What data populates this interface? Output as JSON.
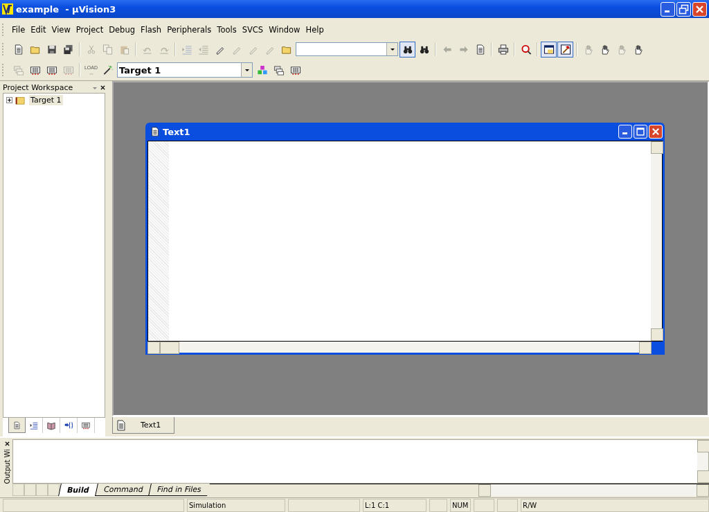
{
  "window": {
    "title": "example  - µVision3"
  },
  "menu": [
    "File",
    "Edit",
    "View",
    "Project",
    "Debug",
    "Flash",
    "Peripherals",
    "Tools",
    "SVCS",
    "Window",
    "Help"
  ],
  "toolbar1": {
    "groups": [
      [
        {
          "kind": "page",
          "disabled": false,
          "pressed": false
        },
        {
          "kind": "folder",
          "disabled": false,
          "pressed": false
        },
        {
          "kind": "floppy",
          "disabled": false,
          "pressed": false
        },
        {
          "kind": "floppies",
          "disabled": false,
          "pressed": false
        }
      ],
      [
        {
          "kind": "scissors",
          "disabled": true,
          "pressed": false
        },
        {
          "kind": "pages",
          "disabled": true,
          "pressed": false
        },
        {
          "kind": "clipboard",
          "disabled": true,
          "pressed": false
        }
      ],
      [
        {
          "kind": "undo",
          "disabled": true,
          "pressed": false
        },
        {
          "kind": "redo",
          "disabled": true,
          "pressed": false
        }
      ],
      [
        {
          "kind": "indent",
          "disabled": true,
          "pressed": false
        },
        {
          "kind": "outdent",
          "disabled": true,
          "pressed": false
        },
        {
          "kind": "pencil",
          "disabled": false,
          "pressed": false
        },
        {
          "kind": "pencil",
          "disabled": true,
          "pressed": false
        },
        {
          "kind": "pencil",
          "disabled": true,
          "pressed": false
        },
        {
          "kind": "pencil",
          "disabled": true,
          "pressed": false
        },
        {
          "kind": "folder",
          "disabled": false,
          "pressed": false
        }
      ]
    ],
    "groups_after": [
      [
        {
          "kind": "binoculars",
          "disabled": false,
          "pressed": true
        },
        {
          "kind": "binoculars",
          "disabled": false,
          "pressed": false
        }
      ],
      [
        {
          "kind": "arrow-left",
          "disabled": true,
          "pressed": false
        },
        {
          "kind": "arrow-right",
          "disabled": true,
          "pressed": false
        },
        {
          "kind": "page",
          "disabled": false,
          "pressed": false
        }
      ],
      [
        {
          "kind": "printer",
          "disabled": false,
          "pressed": false
        }
      ],
      [
        {
          "kind": "magnifier",
          "disabled": false,
          "pressed": false
        }
      ],
      [
        {
          "kind": "window",
          "disabled": false,
          "pressed": true
        },
        {
          "kind": "hammer",
          "disabled": false,
          "pressed": true
        }
      ],
      [
        {
          "kind": "hand",
          "disabled": true,
          "pressed": false
        },
        {
          "kind": "hand",
          "disabled": false,
          "pressed": false
        },
        {
          "kind": "hand",
          "disabled": true,
          "pressed": false
        },
        {
          "kind": "hand",
          "disabled": false,
          "pressed": false
        }
      ]
    ]
  },
  "toolbar2": {
    "groups": [
      [
        {
          "kind": "stack",
          "disabled": true,
          "pressed": false
        },
        {
          "kind": "grid",
          "disabled": false,
          "pressed": false
        },
        {
          "kind": "grid",
          "disabled": false,
          "pressed": false
        },
        {
          "kind": "grid",
          "disabled": true,
          "pressed": false
        }
      ],
      [
        {
          "kind": "load",
          "label": "LOAD",
          "disabled": true,
          "pressed": false
        },
        {
          "kind": "wand",
          "disabled": false,
          "pressed": false
        }
      ]
    ],
    "target_combo": {
      "value": "Target 1"
    },
    "groups_after": [
      [
        {
          "kind": "blocks",
          "disabled": false,
          "pressed": false
        },
        {
          "kind": "stack",
          "disabled": false,
          "pressed": false
        },
        {
          "kind": "grid",
          "disabled": false,
          "pressed": false
        }
      ]
    ]
  },
  "project_workspace": {
    "title": "Project Workspace",
    "tree": [
      {
        "label": "Target 1",
        "expanded": false,
        "selected": true
      }
    ],
    "tabs": [
      {
        "kind": "page",
        "selected": true
      },
      {
        "kind": "indent",
        "selected": false
      },
      {
        "kind": "book",
        "selected": false
      },
      {
        "kind": "braces",
        "selected": false
      },
      {
        "kind": "grid",
        "selected": false
      }
    ]
  },
  "document_window": {
    "title": "Text1"
  },
  "document_tabs": [
    {
      "label": "Text1",
      "selected": true
    }
  ],
  "output_window": {
    "title": "Output Wi",
    "tabs": [
      {
        "label": "Build",
        "selected": true
      },
      {
        "label": "Command",
        "selected": false
      },
      {
        "label": "Find in Files",
        "selected": false
      }
    ]
  },
  "status_bar": [
    "Simulation",
    "L:1 C:1",
    "NUM",
    "R/W"
  ]
}
